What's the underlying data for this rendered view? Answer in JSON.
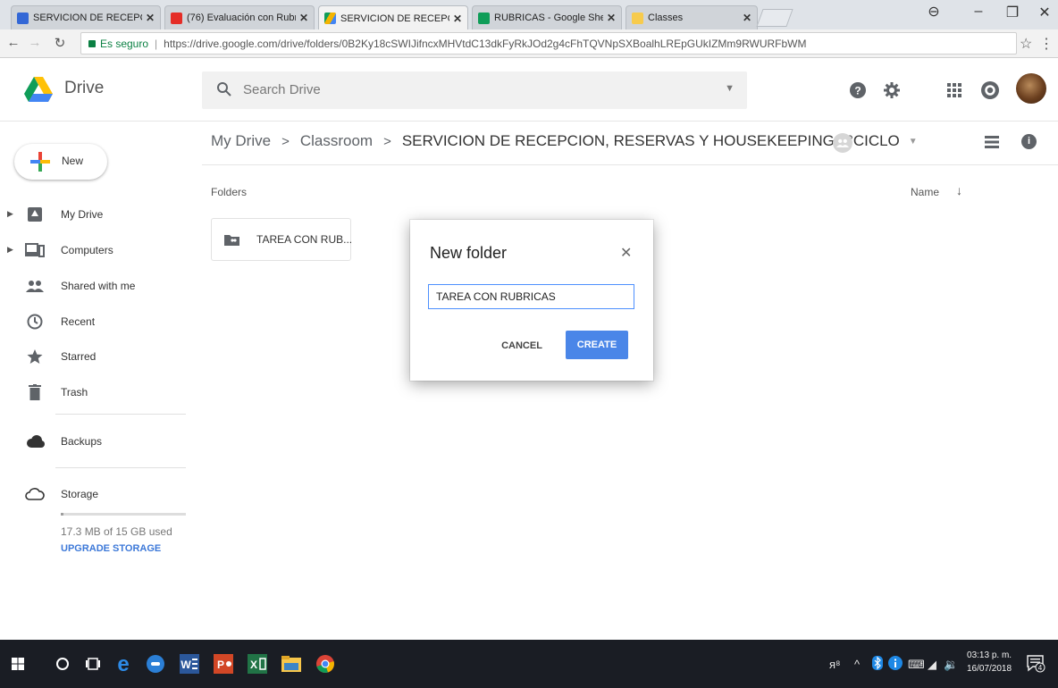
{
  "browser": {
    "tabs": [
      {
        "label": "SERVICION DE RECEPCIC",
        "favicon_color": "#3367d6",
        "active": false
      },
      {
        "label": "(76) Evaluación con Rubr",
        "favicon_color": "#e52d27",
        "active": false
      },
      {
        "label": "SERVICION DE RECEPCIC",
        "favicon_color": "#f4b400",
        "active": true
      },
      {
        "label": "RUBRICAS - Google Shee",
        "favicon_color": "#0f9d58",
        "active": false
      },
      {
        "label": "Classes",
        "favicon_color": "#f7cb4d",
        "active": false
      }
    ],
    "secure_label": "Es seguro",
    "url": "https://drive.google.com/drive/folders/0B2Ky18cSWIJifncxMHVtdC13dkFyRkJOd2g4cFhTQVNpSXBoalhLREpGUkIZMm9RWURFbWM"
  },
  "drive": {
    "app_title": "Drive",
    "search_placeholder": "Search Drive",
    "new_label": "New",
    "sidebar": {
      "items": [
        {
          "label": "My Drive",
          "icon": "my-drive-icon",
          "expandable": true
        },
        {
          "label": "Computers",
          "icon": "computers-icon",
          "expandable": true
        },
        {
          "label": "Shared with me",
          "icon": "shared-with-me-icon",
          "expandable": false
        },
        {
          "label": "Recent",
          "icon": "clock-icon",
          "expandable": false
        },
        {
          "label": "Starred",
          "icon": "star-icon",
          "expandable": false
        },
        {
          "label": "Trash",
          "icon": "trash-icon",
          "expandable": false
        }
      ],
      "backups_label": "Backups",
      "storage_label": "Storage",
      "quota_text": "17.3 MB of 15 GB used",
      "quota_used_fraction": 0.02,
      "upgrade_label": "UPGRADE STORAGE"
    },
    "breadcrumb": {
      "root": "My Drive",
      "middle": "Classroom",
      "current": "SERVICION DE RECEPCION, RESERVAS Y HOUSEKEEPING 7°CICLO"
    },
    "folders_heading": "Folders",
    "sort_label": "Name",
    "folders": [
      {
        "label": "TAREA CON RUB..."
      }
    ]
  },
  "dialog": {
    "title": "New folder",
    "input_value": "TAREA CON RUBRICAS",
    "cancel_label": "CANCEL",
    "create_label": "CREATE"
  },
  "taskbar": {
    "time": "03:13 p. m.",
    "date": "16/07/2018",
    "notification_count": "4"
  }
}
